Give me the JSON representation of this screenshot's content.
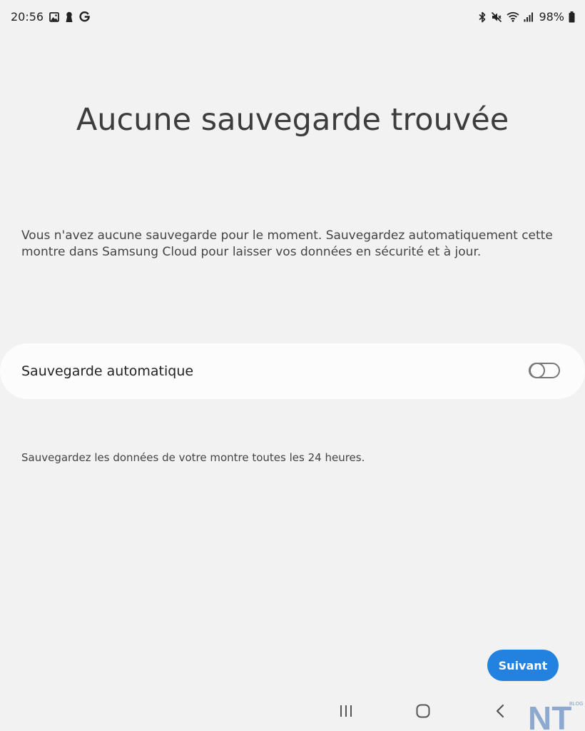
{
  "status_bar": {
    "time": "20:56",
    "left_icons": [
      "image-icon",
      "keyhole-icon",
      "google-icon"
    ],
    "right_icons": [
      "bluetooth-icon",
      "mute-icon",
      "wifi-icon",
      "signal-icon",
      "battery-icon"
    ],
    "battery": "98%"
  },
  "page": {
    "title": "Aucune sauvegarde trouvée",
    "description": "Vous n'avez aucune sauvegarde pour le moment. Sauvegardez automatiquement cette montre dans Samsung Cloud pour laisser vos données en sécurité et à jour."
  },
  "auto_backup": {
    "label": "Sauvegarde automatique",
    "enabled": false
  },
  "helper": {
    "text": "Sauvegardez les données de votre montre toutes les 24 heures."
  },
  "actions": {
    "next_label": "Suivant"
  },
  "navigation_bar": {
    "buttons": [
      "recent-apps-icon",
      "home-icon",
      "back-icon"
    ]
  },
  "watermark": {
    "letters": "NT",
    "small_text": "BLOG"
  },
  "colors": {
    "background": "#f2f2f2",
    "card": "#fcfcfc",
    "accent": "#2382e0"
  }
}
